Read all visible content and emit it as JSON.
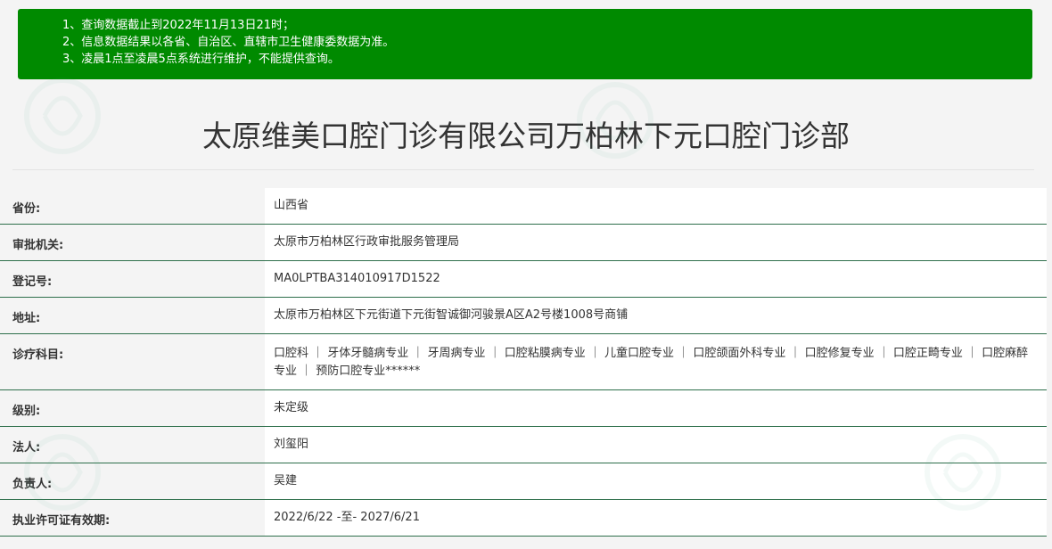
{
  "notice": {
    "lines": [
      "1、查询数据截止到2022年11月13日21时；",
      "2、信息数据结果以各省、自治区、直辖市卫生健康委数据为准。",
      "3、凌晨1点至凌晨5点系统进行维护，不能提供查询。"
    ]
  },
  "title": "太原维美口腔门诊有限公司万柏林下元口腔门诊部",
  "fields": [
    {
      "label": "省份:",
      "value": "山西省"
    },
    {
      "label": "审批机关:",
      "value": "太原市万柏林区行政审批服务管理局"
    },
    {
      "label": "登记号:",
      "value": "MA0LPTBA314010917D1522"
    },
    {
      "label": "地址:",
      "value": "太原市万柏林区下元街道下元街智诚御河骏景A区A2号楼1008号商铺"
    },
    {
      "label": "诊疗科目:",
      "value": "口腔科 ｜ 牙体牙髓病专业 ｜ 牙周病专业 ｜ 口腔粘膜病专业 ｜ 儿童口腔专业 ｜ 口腔颌面外科专业 ｜ 口腔修复专业 ｜ 口腔正畸专业 ｜ 口腔麻醉专业 ｜ 预防口腔专业******"
    },
    {
      "label": "级别:",
      "value": "未定级"
    },
    {
      "label": "法人:",
      "value": "刘玺阳"
    },
    {
      "label": "负责人:",
      "value": "吴建"
    },
    {
      "label": "执业许可证有效期:",
      "value": "2022/6/22 -至- 2027/6/21"
    }
  ],
  "colors": {
    "notice_bg": "#008a00",
    "row_border": "#2e6f4b"
  }
}
